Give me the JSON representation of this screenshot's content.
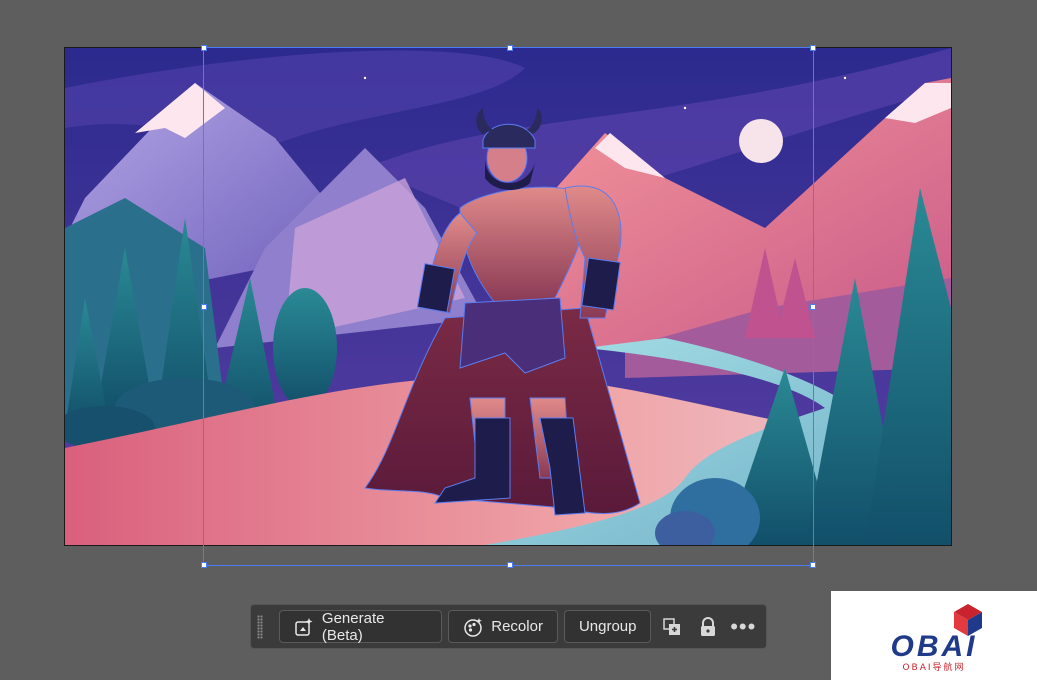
{
  "toolbar": {
    "generate_label": "Generate (Beta)",
    "recolor_label": "Recolor",
    "ungroup_label": "Ungroup",
    "arrange_icon": "arrange-icon",
    "lock_icon": "lock-icon",
    "more_label": "•••"
  },
  "artwork": {
    "subject": "warrior-illustration",
    "accent_selection": "#4b7bf5"
  },
  "watermark": {
    "brand": "OBAI",
    "tagline": "OBAI导航网"
  }
}
